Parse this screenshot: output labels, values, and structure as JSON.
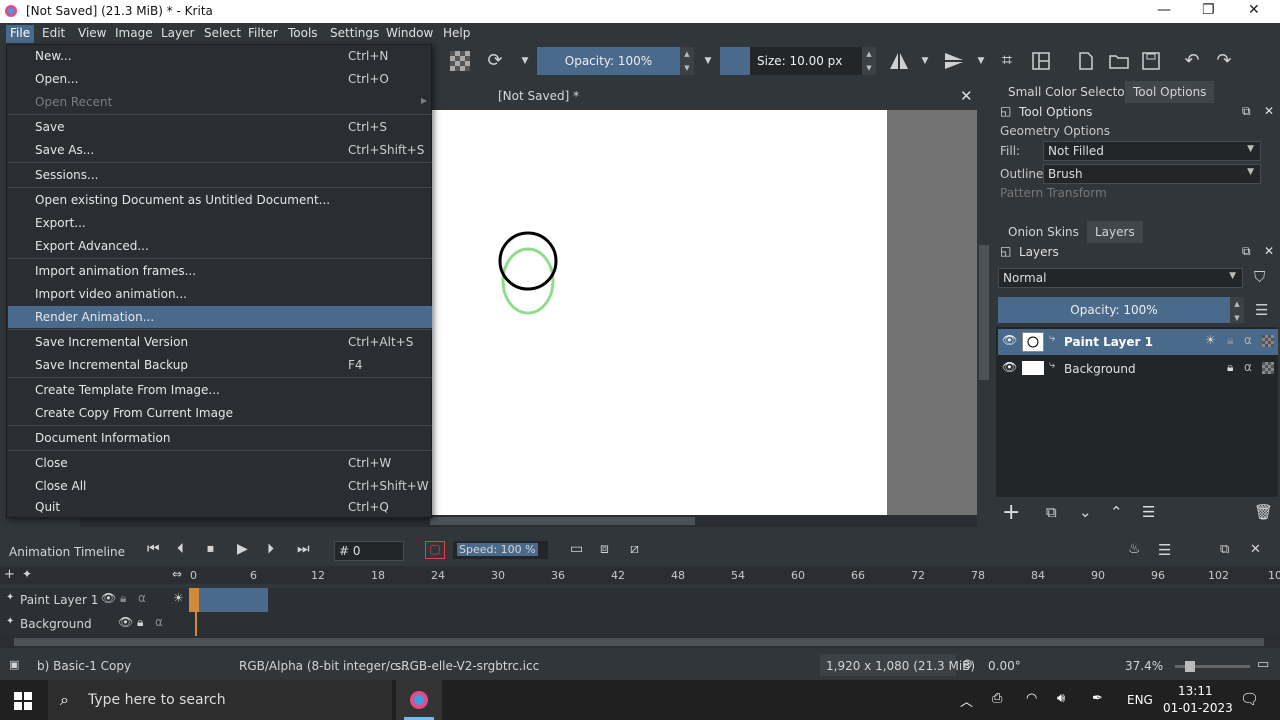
{
  "titlebar": {
    "title": "[Not Saved]  (21.3 MiB)  * - Krita",
    "minimize": "—",
    "restore": "❐",
    "close": "✕"
  },
  "menubar": {
    "items": [
      "File",
      "Edit",
      "View",
      "Image",
      "Layer",
      "Select",
      "Filter",
      "Tools",
      "Settings",
      "Window",
      "Help"
    ]
  },
  "toolbar": {
    "opacity": "Opacity: 100%",
    "size": "Size: 10.00 px"
  },
  "canvas": {
    "tab_title": "[Not Saved]  *"
  },
  "file_menu": {
    "items": [
      {
        "label": "New...",
        "shortcut": "Ctrl+N"
      },
      {
        "label": "Open...",
        "shortcut": "Ctrl+O"
      },
      {
        "label": "Open Recent",
        "shortcut": ""
      },
      {
        "label": "Save",
        "shortcut": "Ctrl+S"
      },
      {
        "label": "Save As...",
        "shortcut": "Ctrl+Shift+S"
      },
      {
        "label": "Sessions...",
        "shortcut": ""
      },
      {
        "label": "Open existing Document as Untitled Document...",
        "shortcut": ""
      },
      {
        "label": "Export...",
        "shortcut": ""
      },
      {
        "label": "Export Advanced...",
        "shortcut": ""
      },
      {
        "label": "Import animation frames...",
        "shortcut": ""
      },
      {
        "label": "Import video animation...",
        "shortcut": ""
      },
      {
        "label": "Render Animation...",
        "shortcut": ""
      },
      {
        "label": "Save Incremental Version",
        "shortcut": "Ctrl+Alt+S"
      },
      {
        "label": "Save Incremental Backup",
        "shortcut": "F4"
      },
      {
        "label": "Create Template From Image...",
        "shortcut": ""
      },
      {
        "label": "Create Copy From Current Image",
        "shortcut": ""
      },
      {
        "label": "Document Information",
        "shortcut": ""
      },
      {
        "label": "Close",
        "shortcut": "Ctrl+W"
      },
      {
        "label": "Close All",
        "shortcut": "Ctrl+Shift+W"
      },
      {
        "label": "Quit",
        "shortcut": "Ctrl+Q"
      }
    ]
  },
  "dock": {
    "tabs_top": [
      "Small Color Selector",
      "Tool Options"
    ],
    "tool_options": {
      "header": "Tool Options",
      "section": "Geometry Options",
      "fill_label": "Fill:",
      "fill_value": "Not Filled",
      "outline_label": "Outline:",
      "outline_value": "Brush",
      "pattern": "Pattern Transform"
    },
    "tabs_mid": [
      "Onion Skins",
      "Layers"
    ],
    "layers": {
      "header": "Layers",
      "blend": "Normal",
      "opacity": "Opacity:  100%",
      "items": [
        {
          "name": "Paint Layer 1"
        },
        {
          "name": "Background"
        }
      ]
    }
  },
  "timeline": {
    "title": "Animation Timeline",
    "frame": "# 0",
    "speed": "Speed: 100 %",
    "ticks": [
      "0",
      "6",
      "12",
      "18",
      "24",
      "30",
      "36",
      "42",
      "48",
      "54",
      "60",
      "66",
      "72",
      "78",
      "84",
      "90",
      "96",
      "102",
      "10"
    ],
    "layers": [
      "Paint Layer 1",
      "Background"
    ]
  },
  "statusbar": {
    "brush": "b) Basic-1 Copy",
    "colorspace": "RGB/Alpha (8-bit integer/c...",
    "profile": "sRGB-elle-V2-srgbtrc.icc",
    "dimensions": "1,920 x 1,080 (21.3 MiB)",
    "rotation": "0.00°",
    "zoom": "37.4%"
  },
  "taskbar": {
    "search_placeholder": "Type here to search",
    "lang": "ENG",
    "time": "13:11",
    "date": "01-01-2023"
  }
}
